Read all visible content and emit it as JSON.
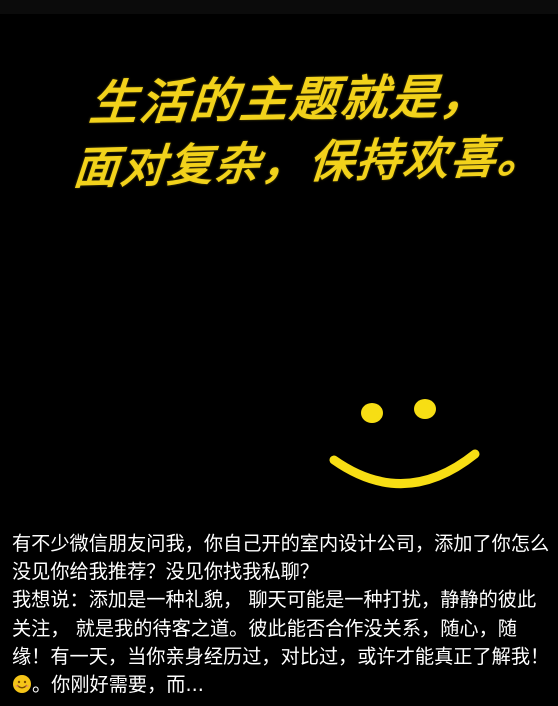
{
  "quote": {
    "line1": "生活的主题就是，",
    "line2": "面对复杂，保持欢喜。"
  },
  "caption": {
    "text_before_emoji": "有不少微信朋友问我，你自己开的室内设计公司，添加了你怎么没见你给我推荐？没见你找我私聊？\n我想说：添加是一种礼貌， 聊天可能是一种打扰，静静的彼此关注， 就是我的待客之道。彼此能否合作没关系，随心，随缘！有一天，当你亲身经历过，对比过，或许才能真正了解我！",
    "emoji_icon": "smiling-face-emoji",
    "text_after_emoji": "。你刚好需要，而..."
  },
  "colors": {
    "background": "#000000",
    "quote_yellow": "#f2d21b",
    "smiley_yellow": "#f7de14",
    "caption_text": "#ffffff"
  }
}
